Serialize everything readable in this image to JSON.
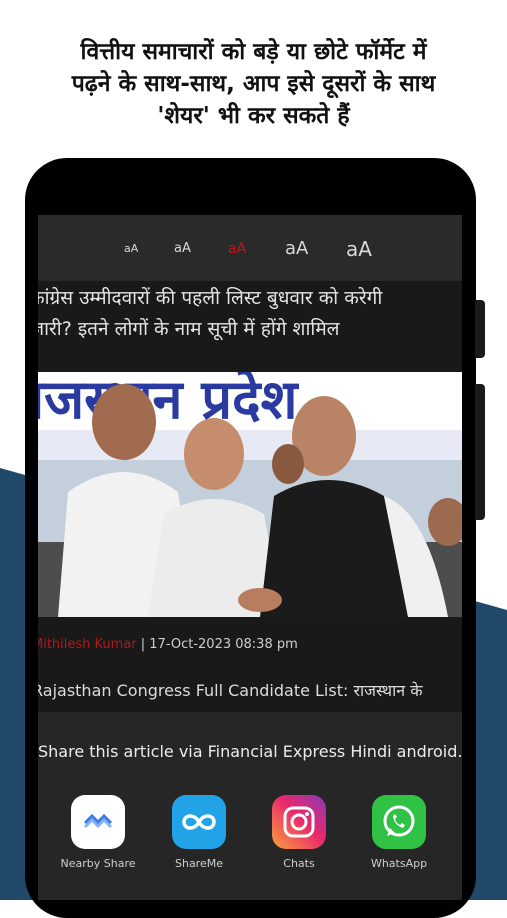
{
  "promo": {
    "title": "वित्तीय समाचारों को बड़े या छोटे फॉर्मेट में\nपढ़ने के साथ-साथ, आप इसे दूसरों के साथ\n'शेयर' भी कर सकते हैं"
  },
  "colors": {
    "background_navy": "#1f4869",
    "accent_red": "#c0171c"
  },
  "font_size_options": [
    {
      "label": "aA",
      "selected": false
    },
    {
      "label": "aA",
      "selected": false
    },
    {
      "label": "aA",
      "selected": true
    },
    {
      "label": "aA",
      "selected": false
    },
    {
      "label": "aA",
      "selected": false
    }
  ],
  "article": {
    "headline": "कांग्रेस उम्मीदवारों की पहली लिस्ट बुधवार को करेगी\nजारी? इतने लोगों के नाम सूची में होंगे शामिल",
    "photo_banner_text": "राजस्थान प्रदेश",
    "author": "Mithilesh Kumar",
    "date": "| 17-Oct-2023 08:38 pm",
    "teaser": "Rajasthan Congress Full Candidate List: राजस्थान के"
  },
  "share_sheet": {
    "title": "Share this article via Financial Express Hindi android...",
    "apps": [
      {
        "label": "Nearby Share",
        "icon": "nearby-share-icon"
      },
      {
        "label": "ShareMe",
        "icon": "shareme-icon"
      },
      {
        "label": "Chats",
        "icon": "instagram-icon"
      },
      {
        "label": "WhatsApp",
        "icon": "whatsapp-icon"
      }
    ]
  }
}
